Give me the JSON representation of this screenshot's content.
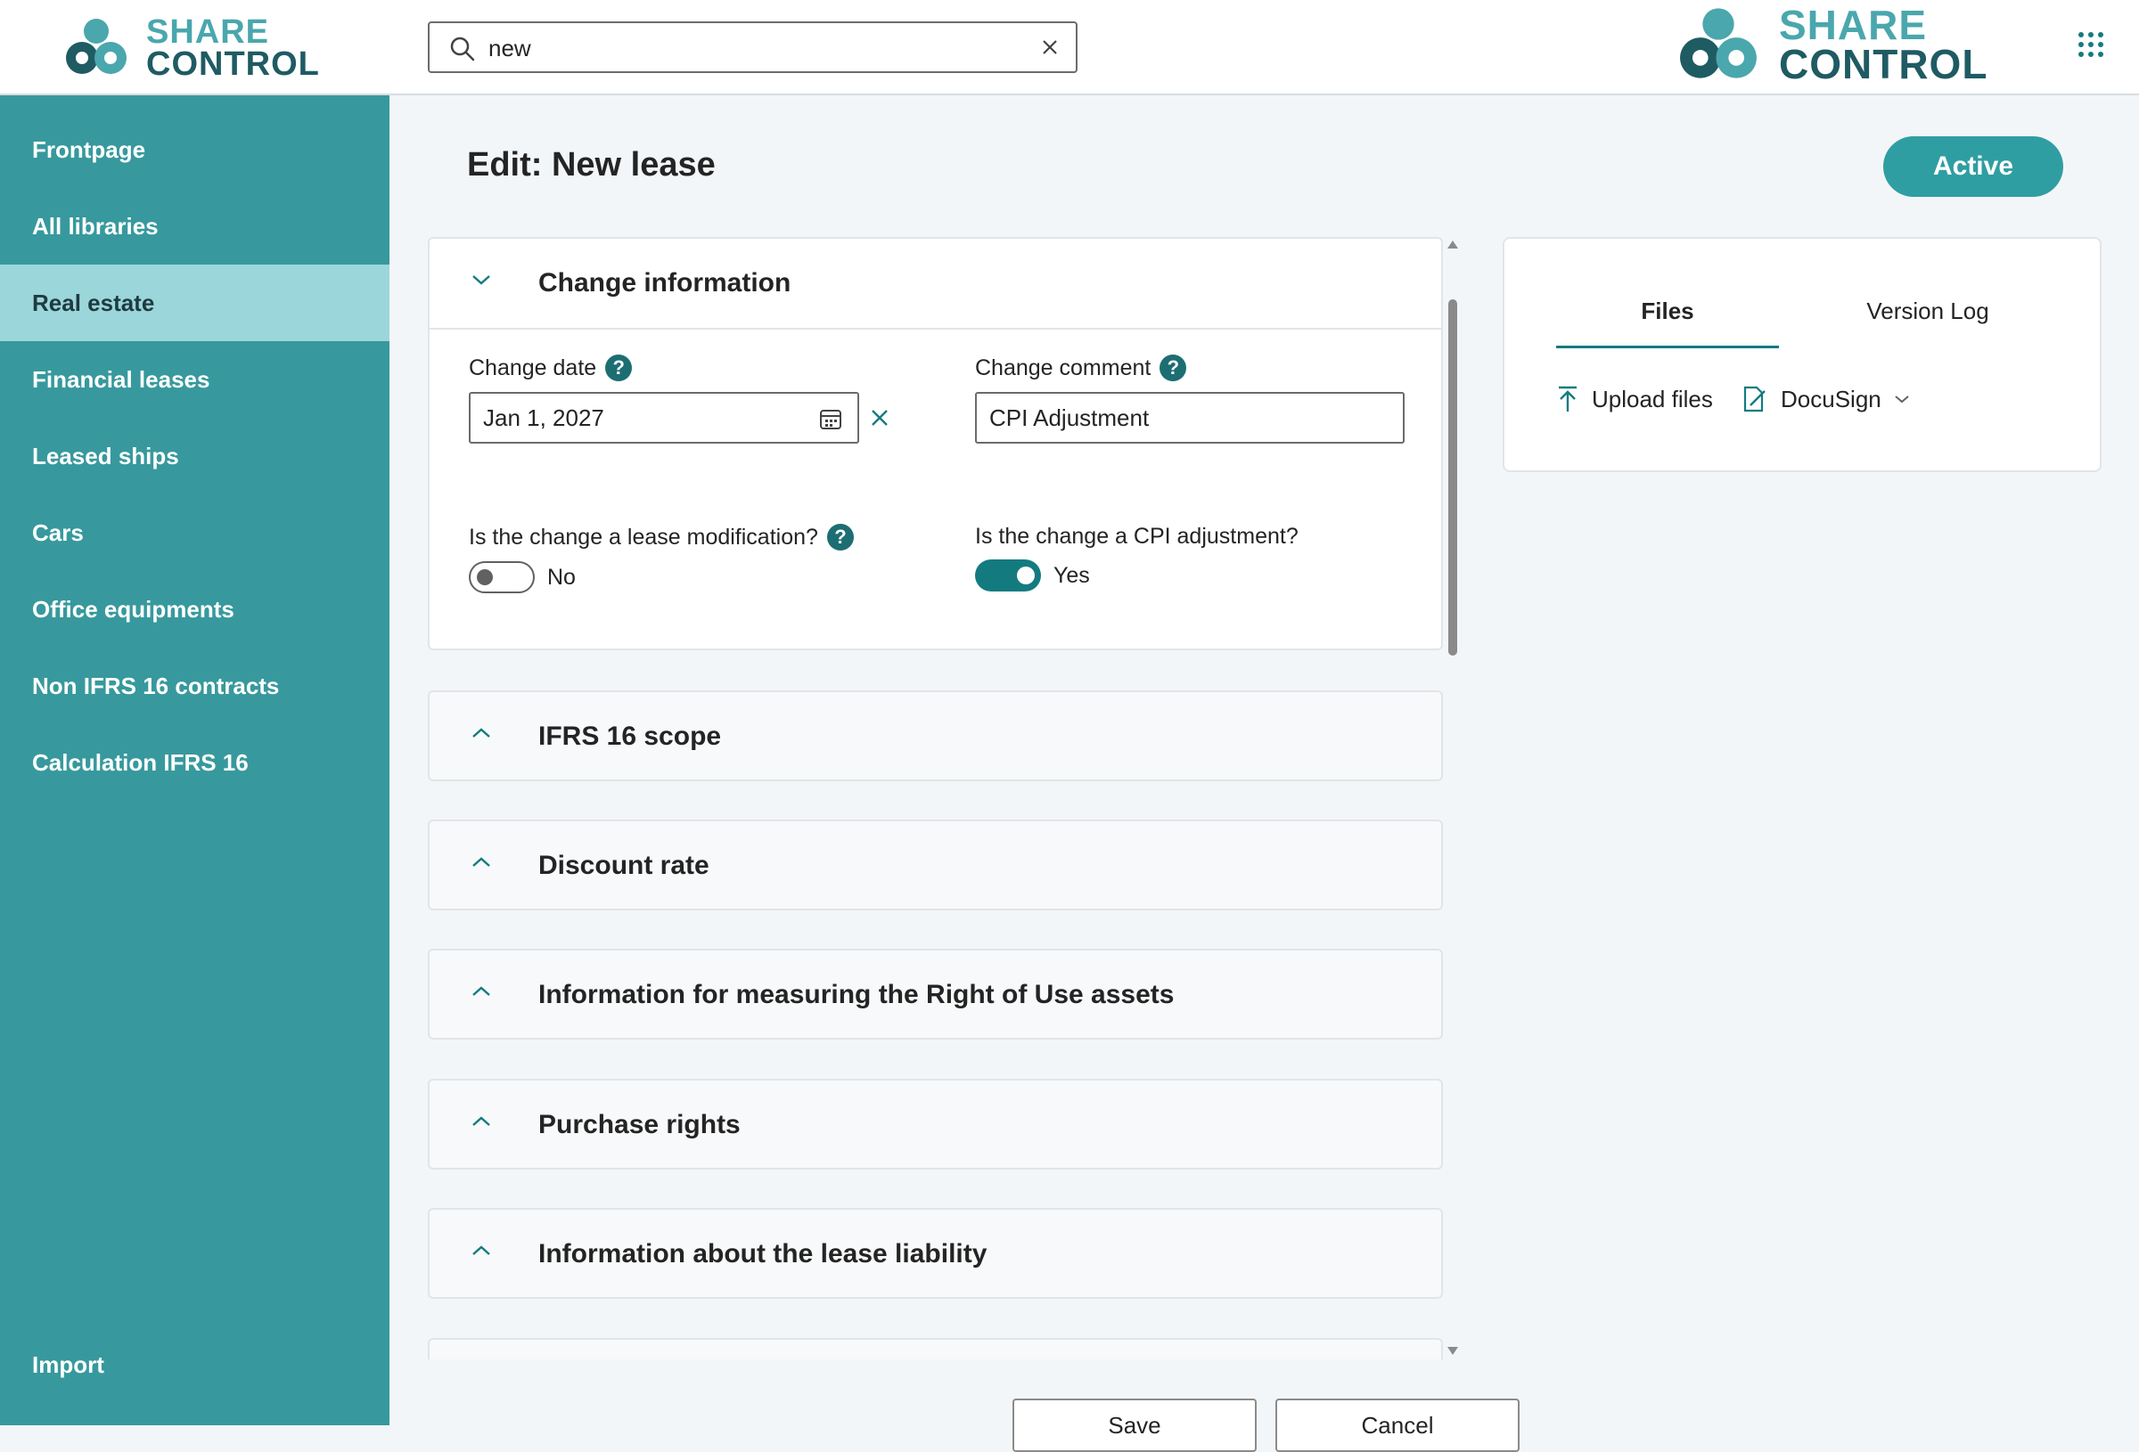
{
  "brand": {
    "line1": "SHARE",
    "line2": "CONTROL"
  },
  "search": {
    "value": "new"
  },
  "sidebar": {
    "items": [
      {
        "label": "Frontpage"
      },
      {
        "label": "All libraries"
      },
      {
        "label": "Real estate",
        "selected": true
      },
      {
        "label": "Financial leases"
      },
      {
        "label": "Leased ships"
      },
      {
        "label": "Cars"
      },
      {
        "label": "Office equipments"
      },
      {
        "label": "Non IFRS 16 contracts"
      },
      {
        "label": "Calculation IFRS 16"
      }
    ],
    "bottom_item": {
      "label": "Import"
    }
  },
  "page": {
    "title": "Edit: New lease",
    "status": "Active"
  },
  "change_info": {
    "title": "Change information",
    "change_date": {
      "label": "Change date",
      "value": "Jan 1, 2027"
    },
    "change_comment": {
      "label": "Change comment",
      "value": "CPI Adjustment"
    },
    "lease_modification": {
      "label": "Is the change a lease modification?",
      "state": "No"
    },
    "cpi_adjustment": {
      "label": "Is the change a CPI adjustment?",
      "state": "Yes"
    }
  },
  "sections": [
    {
      "title": "IFRS 16 scope"
    },
    {
      "title": "Discount rate"
    },
    {
      "title": "Information for measuring the Right of Use assets"
    },
    {
      "title": "Purchase rights"
    },
    {
      "title": "Information about the lease liability"
    }
  ],
  "files_panel": {
    "tabs": [
      {
        "label": "Files",
        "active": true
      },
      {
        "label": "Version Log"
      }
    ],
    "upload_label": "Upload files",
    "docusign_label": "DocuSign"
  },
  "footer": {
    "save_label": "Save",
    "cancel_label": "Cancel"
  },
  "colors": {
    "sidebar": "#37999d",
    "sidebar_selected": "#9bd6db",
    "accent": "#137b80",
    "status_pill": "#2f9ea3"
  }
}
